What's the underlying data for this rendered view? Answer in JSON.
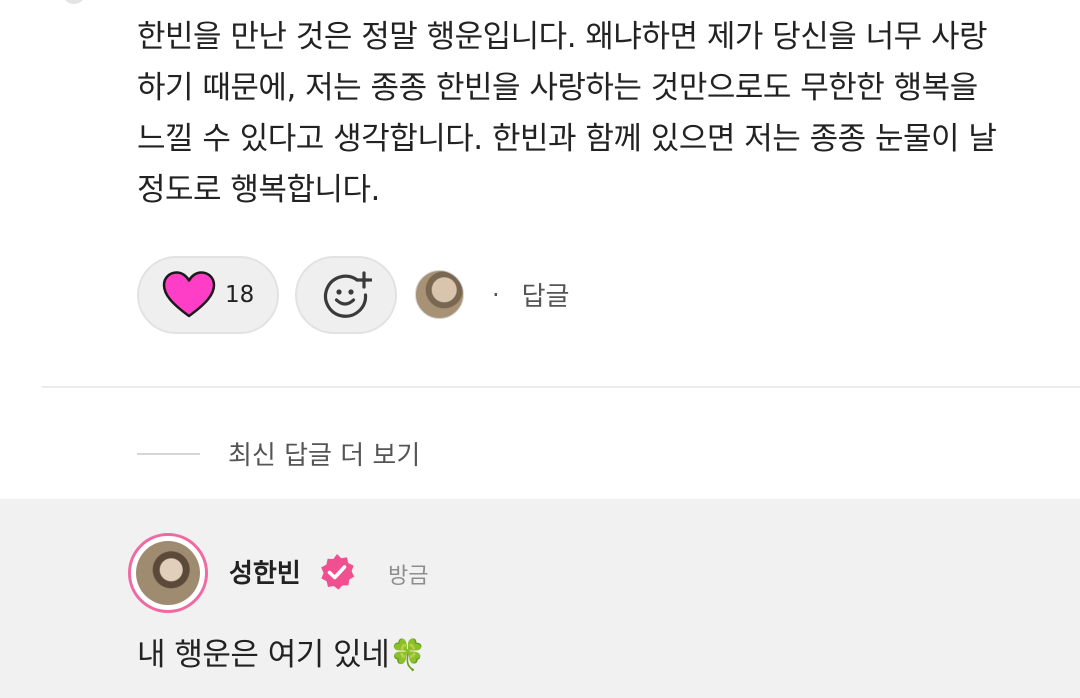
{
  "comment": {
    "text": "한빈을 만난 것은 정말 행운입니다. 왜냐하면 제가 당신을 너무 사랑\n하기 때문에, 저는 종종 한빈을 사랑하는 것만으로도 무한한 행복을\n느낄 수 있다고 생각합니다. 한빈과 함께 있으면 저는 종종 눈물이 날\n정도로 행복합니다.",
    "like_count": "18",
    "separator": "·",
    "reply_label": "답글",
    "heart_color": "#ff3ec8",
    "heart_icon": "heart-icon",
    "reaction_icon": "add-reaction-icon"
  },
  "more_replies": {
    "label": "최신 답글 더 보기"
  },
  "reply": {
    "author": "성한빈",
    "time": "방금",
    "text": "내 행운은 여기 있네",
    "emoji": "🍀",
    "verified_color": "#f0508f",
    "ring_color": "#f06aa2",
    "verified_icon": "verified-badge-icon"
  }
}
